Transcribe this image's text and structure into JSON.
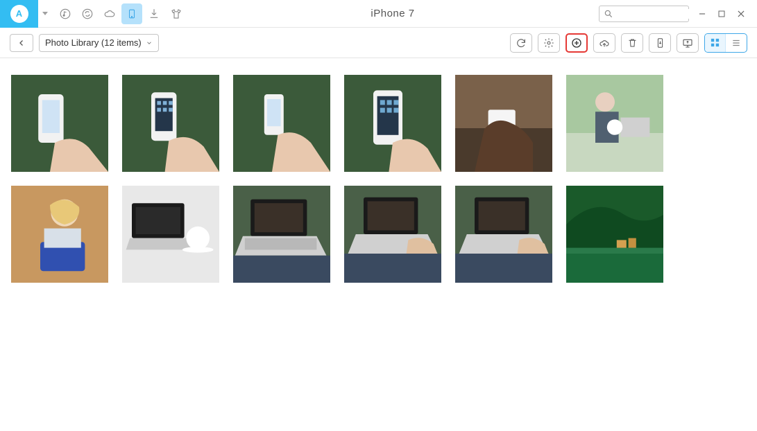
{
  "app": {
    "brand_letter": "A",
    "device_title": "iPhone  7",
    "search_placeholder": ""
  },
  "nav": {
    "music_icon": "music",
    "sync_icon": "sync",
    "cloud_icon": "cloud",
    "device_icon": "device",
    "download_icon": "download",
    "tshirt_icon": "tshirt"
  },
  "toolbar": {
    "back_label": "Back",
    "crumb_label": "Photo Library (12 items)",
    "refresh_tip": "Refresh",
    "settings_tip": "Settings",
    "add_tip": "Add",
    "to_cloud_tip": "To iCloud",
    "delete_tip": "Delete",
    "to_device_tip": "To Device",
    "to_pc_tip": "To PC",
    "grid_view": "Grid",
    "list_view": "List"
  },
  "window": {
    "minimize": "Minimize",
    "maximize": "Maximize",
    "close": "Close"
  },
  "photos": [
    {
      "name": "phone-hand-1"
    },
    {
      "name": "phone-hand-2"
    },
    {
      "name": "phone-hand-3"
    },
    {
      "name": "phone-hand-4"
    },
    {
      "name": "reading-phone"
    },
    {
      "name": "man-coffee-laptop"
    },
    {
      "name": "woman-laptop"
    },
    {
      "name": "laptop-coffee-cup"
    },
    {
      "name": "laptop-lap-1"
    },
    {
      "name": "laptop-lap-2"
    },
    {
      "name": "laptop-lap-3"
    },
    {
      "name": "green-mountain-lake"
    }
  ]
}
